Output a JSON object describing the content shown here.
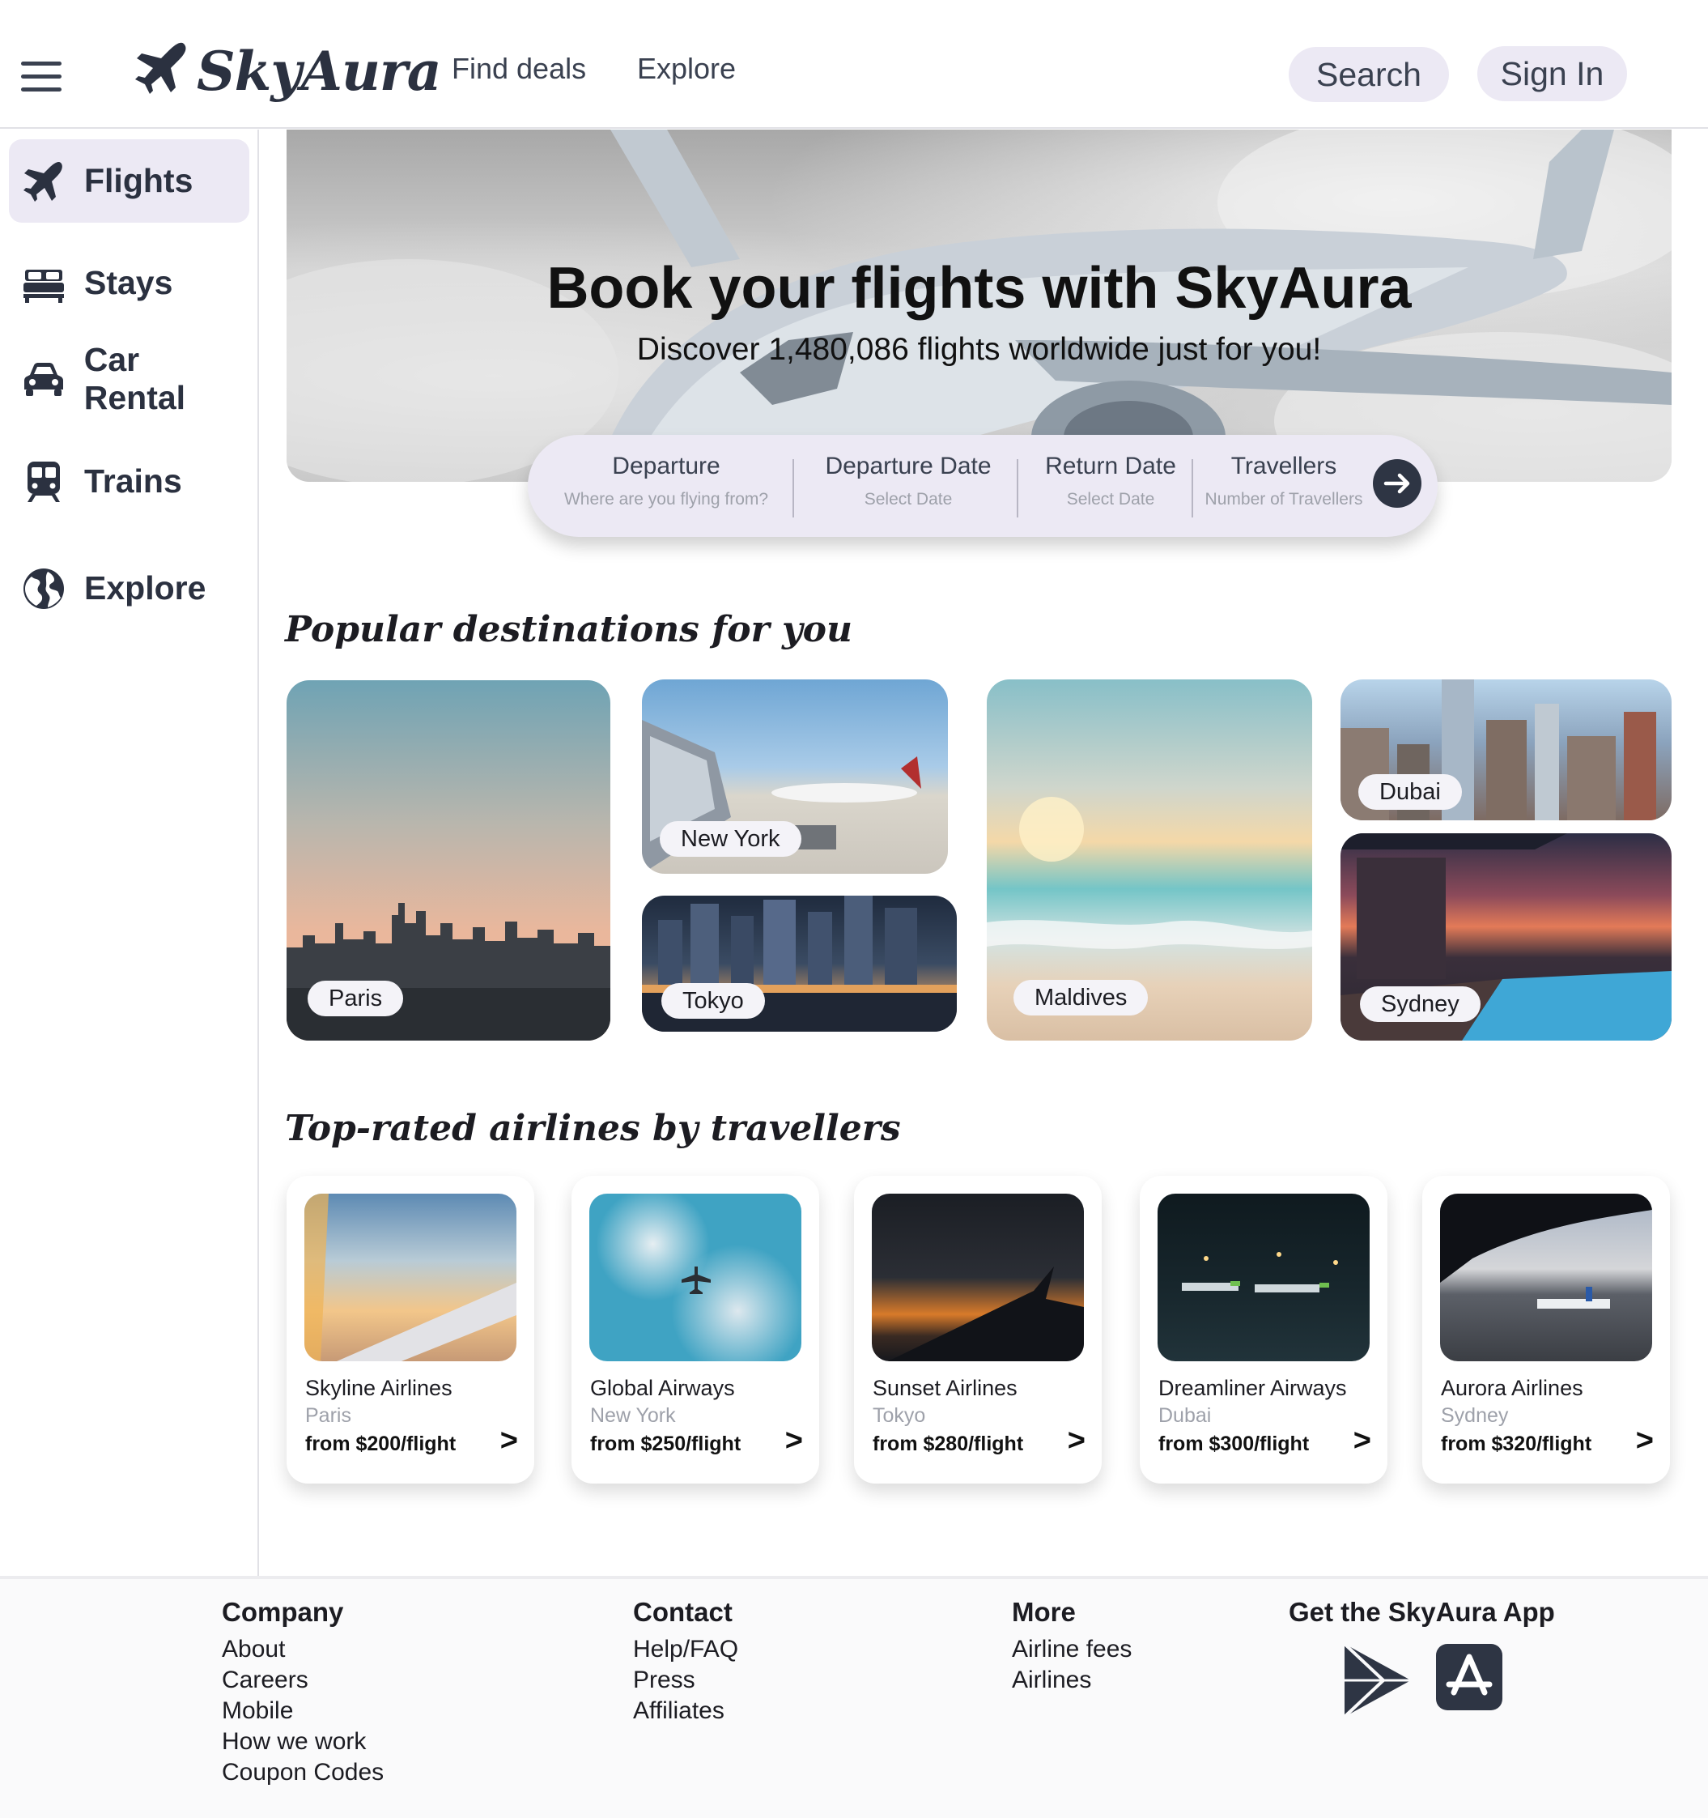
{
  "header": {
    "brand": "SkyAura",
    "nav": [
      {
        "label": "Find deals"
      },
      {
        "label": "Explore"
      }
    ],
    "search_label": "Search",
    "signin_label": "Sign In"
  },
  "sidebar": {
    "items": [
      {
        "label": "Flights",
        "icon": "airplane-icon",
        "active": true
      },
      {
        "label": "Stays",
        "icon": "bed-icon"
      },
      {
        "label": "Car Rental",
        "icon": "car-icon"
      },
      {
        "label": "Trains",
        "icon": "train-icon"
      },
      {
        "label": "Explore",
        "icon": "globe-icon"
      }
    ]
  },
  "hero": {
    "title": "Book your flights with SkyAura",
    "subtitle": "Discover 1,480,086 flights worldwide just for you!"
  },
  "searchbar": {
    "fields": [
      {
        "label": "Departure",
        "hint": "Where are you flying from?"
      },
      {
        "label": "Departure Date",
        "hint": "Select Date"
      },
      {
        "label": "Return Date",
        "hint": "Select Date"
      },
      {
        "label": "Travellers",
        "hint": "Number of Travellers"
      }
    ],
    "go_icon": "arrow-right-icon"
  },
  "popular": {
    "title": "Popular destinations for you",
    "destinations": [
      {
        "name": "Paris"
      },
      {
        "name": "New York"
      },
      {
        "name": "Tokyo"
      },
      {
        "name": "Maldives"
      },
      {
        "name": "Dubai"
      },
      {
        "name": "Sydney"
      }
    ]
  },
  "airlines": {
    "title": "Top-rated airlines by travellers",
    "cards": [
      {
        "name": "Skyline Airlines",
        "city": "Paris",
        "price": "from $200/flight",
        "arrow": ">"
      },
      {
        "name": "Global Airways",
        "city": "New York",
        "price": "from $250/flight",
        "arrow": ">"
      },
      {
        "name": "Sunset Airlines",
        "city": "Tokyo",
        "price": "from $280/flight",
        "arrow": ">"
      },
      {
        "name": "Dreamliner Airways",
        "city": "Dubai",
        "price": "from $300/flight",
        "arrow": ">"
      },
      {
        "name": "Aurora Airlines",
        "city": "Sydney",
        "price": "from $320/flight",
        "arrow": ">"
      }
    ]
  },
  "footer": {
    "company": {
      "title": "Company",
      "links": [
        "About",
        "Careers",
        "Mobile",
        "How we work",
        "Coupon Codes"
      ]
    },
    "contact": {
      "title": "Contact",
      "links": [
        "Help/FAQ",
        "Press",
        "Affiliates"
      ]
    },
    "more": {
      "title": "More",
      "links": [
        "Airline fees",
        "Airlines"
      ]
    },
    "app": {
      "title": "Get the SkyAura App",
      "icons": [
        "google-play-icon",
        "app-store-icon"
      ]
    }
  },
  "colors": {
    "accent_bg": "#ece9f4",
    "primary_text": "#2b3140",
    "muted_text": "#9ea1aa",
    "icon_dark": "#2e3544"
  }
}
